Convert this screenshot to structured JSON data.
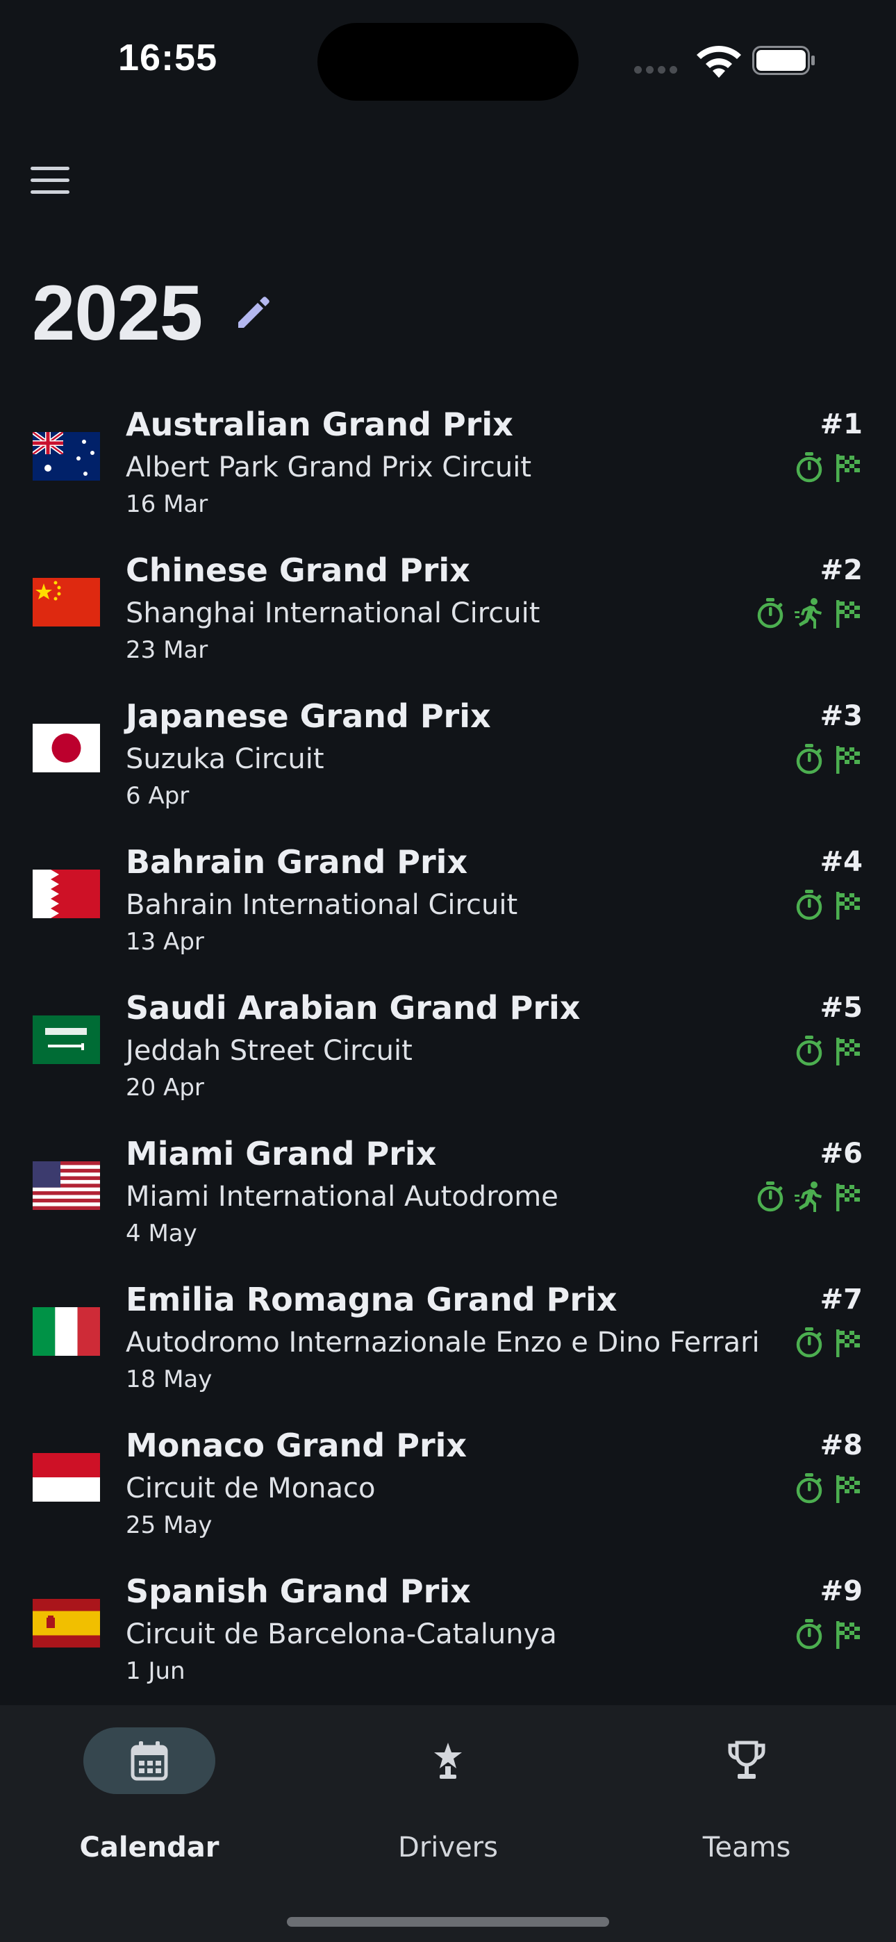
{
  "status_bar": {
    "time": "16:55"
  },
  "header": {
    "year": "2025"
  },
  "races": [
    {
      "name": "Australian Grand Prix",
      "circuit": "Albert Park Grand Prix Circuit",
      "date": "16 Mar",
      "round": "#1",
      "flag": "australia",
      "sessions": [
        "qualifying-stopwatch-icon",
        "race-flag-icon"
      ]
    },
    {
      "name": "Chinese Grand Prix",
      "circuit": "Shanghai International Circuit",
      "date": "23 Mar",
      "round": "#2",
      "flag": "china",
      "sessions": [
        "qualifying-stopwatch-icon",
        "sprint-runner-icon",
        "race-flag-icon"
      ]
    },
    {
      "name": "Japanese Grand Prix",
      "circuit": "Suzuka Circuit",
      "date": "6 Apr",
      "round": "#3",
      "flag": "japan",
      "sessions": [
        "qualifying-stopwatch-icon",
        "race-flag-icon"
      ]
    },
    {
      "name": "Bahrain Grand Prix",
      "circuit": "Bahrain International Circuit",
      "date": "13 Apr",
      "round": "#4",
      "flag": "bahrain",
      "sessions": [
        "qualifying-stopwatch-icon",
        "race-flag-icon"
      ]
    },
    {
      "name": "Saudi Arabian Grand Prix",
      "circuit": "Jeddah Street Circuit",
      "date": "20 Apr",
      "round": "#5",
      "flag": "saudi-arabia",
      "sessions": [
        "qualifying-stopwatch-icon",
        "race-flag-icon"
      ]
    },
    {
      "name": "Miami Grand Prix",
      "circuit": "Miami International Autodrome",
      "date": "4 May",
      "round": "#6",
      "flag": "usa",
      "sessions": [
        "qualifying-stopwatch-icon",
        "sprint-runner-icon",
        "race-flag-icon"
      ]
    },
    {
      "name": "Emilia Romagna Grand Prix",
      "circuit": "Autodromo Internazionale Enzo e Dino Ferrari",
      "date": "18 May",
      "round": "#7",
      "flag": "italy",
      "sessions": [
        "qualifying-stopwatch-icon",
        "race-flag-icon"
      ]
    },
    {
      "name": "Monaco Grand Prix",
      "circuit": "Circuit de Monaco",
      "date": "25 May",
      "round": "#8",
      "flag": "monaco",
      "sessions": [
        "qualifying-stopwatch-icon",
        "race-flag-icon"
      ]
    },
    {
      "name": "Spanish Grand Prix",
      "circuit": "Circuit de Barcelona-Catalunya",
      "date": "1 Jun",
      "round": "#9",
      "flag": "spain",
      "sessions": [
        "qualifying-stopwatch-icon",
        "race-flag-icon"
      ]
    }
  ],
  "bottom_nav": [
    {
      "label": "Calendar",
      "icon": "calendar-icon",
      "active": true
    },
    {
      "label": "Drivers",
      "icon": "driver-star-icon",
      "active": false
    },
    {
      "label": "Teams",
      "icon": "trophy-icon",
      "active": false
    }
  ],
  "colors": {
    "background": "#111418",
    "session_green": "#4caf50",
    "nav_background": "#1b1e22",
    "active_pill": "#36474f",
    "edit_accent": "#b4b8f0"
  }
}
